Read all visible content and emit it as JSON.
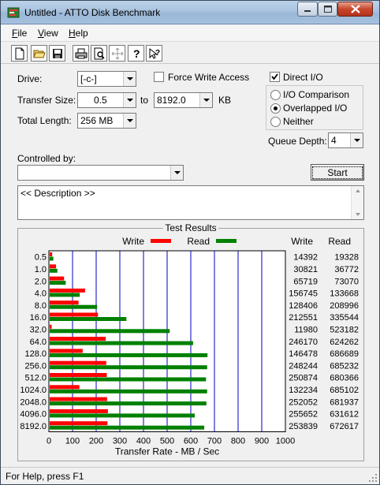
{
  "window": {
    "title": "Untitled - ATTO Disk Benchmark"
  },
  "menu": {
    "file_pre": "",
    "file_u": "F",
    "file_post": "ile",
    "view_u": "V",
    "view_post": "iew",
    "help_u": "H",
    "help_post": "elp"
  },
  "toolbar": [
    "new-document",
    "open-folder",
    "save",
    "print",
    "print-preview",
    "move",
    "help",
    "context-help"
  ],
  "form": {
    "drive_label": "Drive:",
    "drive_value": "[-c-]",
    "force_write_label": "Force Write Access",
    "force_write_checked": false,
    "transfer_size_label": "Transfer Size:",
    "transfer_from": "0.5",
    "to_label": "to",
    "transfer_to": "8192.0",
    "kb_label": "KB",
    "total_length_label": "Total Length:",
    "total_length_value": "256 MB",
    "direct_io_label": "Direct I/O",
    "direct_io_checked": true,
    "io_comparison_label": "I/O Comparison",
    "overlapped_io_label": "Overlapped I/O",
    "neither_label": "Neither",
    "io_mode": "overlapped",
    "queue_depth_label": "Queue Depth:",
    "queue_depth_value": "4",
    "controlled_by_label": "Controlled by:",
    "controlled_by_value": "",
    "start_label": "Start",
    "description": "<< Description >>"
  },
  "results": {
    "title": "Test Results",
    "legend_write": "Write",
    "legend_read": "Read",
    "col_write": "Write",
    "col_read": "Read"
  },
  "colors": {
    "write": "#ff0000",
    "read": "#008000",
    "grid": "#0000c0"
  },
  "chart_data": {
    "type": "bar",
    "title": "Test Results",
    "xlabel": "Transfer Rate - MB / Sec",
    "xlim": [
      0,
      1000
    ],
    "xticks": [
      0,
      100,
      200,
      300,
      400,
      500,
      600,
      700,
      800,
      900,
      1000
    ],
    "categories": [
      "0.5",
      "1.0",
      "2.0",
      "4.0",
      "8.0",
      "16.0",
      "32.0",
      "64.0",
      "128.0",
      "256.0",
      "512.0",
      "1024.0",
      "2048.0",
      "4096.0",
      "8192.0"
    ],
    "series": [
      {
        "name": "Write",
        "values": [
          14392,
          30821,
          65719,
          156745,
          128406,
          212551,
          11980,
          246170,
          146478,
          248244,
          250874,
          132234,
          252052,
          255652,
          253839
        ]
      },
      {
        "name": "Read",
        "values": [
          19328,
          36772,
          73070,
          133668,
          208996,
          335544,
          523182,
          624262,
          686689,
          685232,
          680366,
          685102,
          681937,
          631612,
          672617
        ]
      }
    ]
  },
  "status": {
    "text": "For Help, press F1"
  }
}
